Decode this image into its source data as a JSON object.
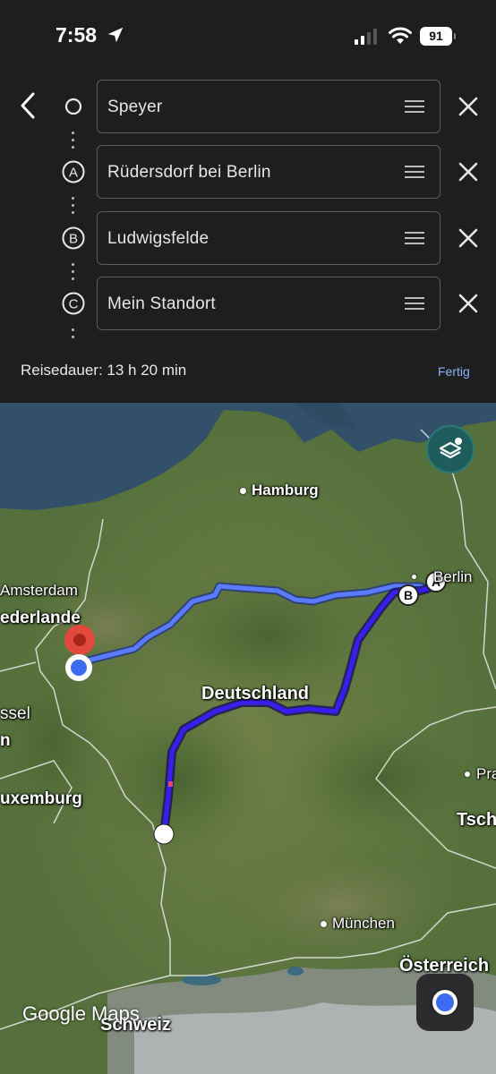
{
  "status_bar": {
    "time": "7:58",
    "battery": "91"
  },
  "stops": [
    {
      "marker": "",
      "value": "Speyer"
    },
    {
      "marker": "A",
      "value": "Rüdersdorf bei Berlin"
    },
    {
      "marker": "B",
      "value": "Ludwigsfelde"
    },
    {
      "marker": "C",
      "value": "Mein Standort"
    }
  ],
  "summary": {
    "duration": "Reisedauer: 13 h 20 min",
    "done_label": "Fertig"
  },
  "map": {
    "labels": {
      "hamburg": "Hamburg",
      "berlin": "Berlin",
      "amsterdam": "Amsterdam",
      "niederlande": "ederlande",
      "brussel": "ssel",
      "n_fragment": "n",
      "deutschland": "Deutschland",
      "luxemburg": "uxemburg",
      "prag": "Pra",
      "tschechien": "Tsch",
      "muenchen": "München",
      "oesterreich": "Österreich",
      "schweiz": "Schweiz"
    },
    "route_markers": {
      "a": "A",
      "b": "B"
    },
    "watermark": "Google Maps",
    "colors": {
      "route_primary": "#3a1df0",
      "route_alt": "#5a7bff",
      "destination_pin": "#e04a3c",
      "my_location": "#3c6cf0"
    }
  }
}
